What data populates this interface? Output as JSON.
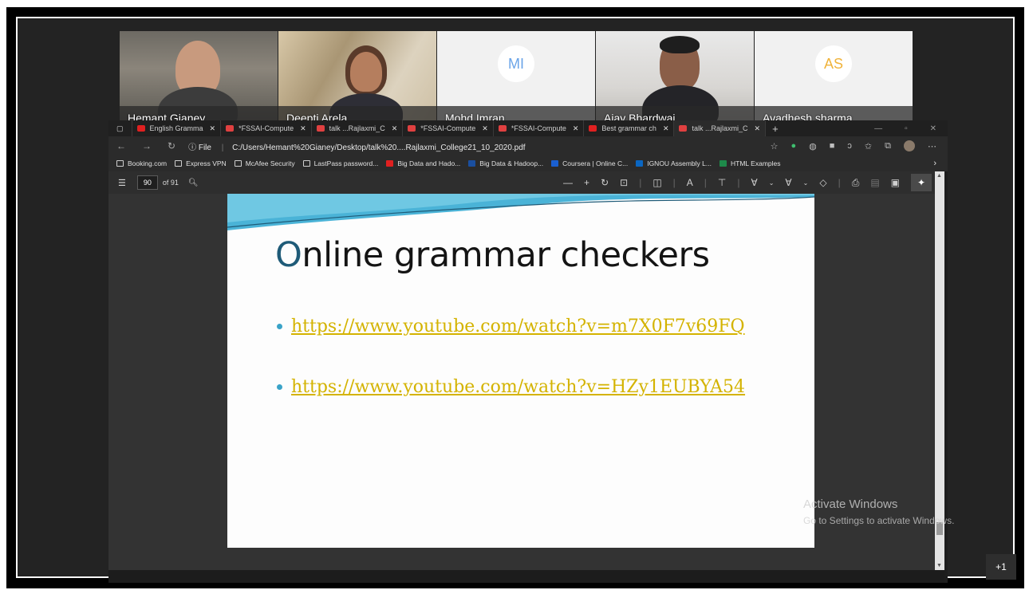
{
  "participants": [
    {
      "name": "Hemant Gianey",
      "type": "video"
    },
    {
      "name": "Deepti Arela",
      "type": "video"
    },
    {
      "name": "Mohd Imran",
      "type": "avatar",
      "initials": "MI"
    },
    {
      "name": "Ajay Bhardwaj",
      "type": "video"
    },
    {
      "name": "Avadhesh sharma",
      "type": "avatar",
      "initials": "AS"
    }
  ],
  "browser": {
    "tabs": [
      {
        "label": "English Gramma",
        "icon": "youtube-icon"
      },
      {
        "label": "*FSSAI-Compute",
        "icon": "pdf-icon"
      },
      {
        "label": "talk ...Rajlaxmi_C",
        "icon": "pdf-icon"
      },
      {
        "label": "*FSSAI-Compute",
        "icon": "pdf-icon"
      },
      {
        "label": "*FSSAI-Compute",
        "icon": "pdf-icon"
      },
      {
        "label": "Best grammar ch",
        "icon": "youtube-icon"
      },
      {
        "label": "talk ...Rajlaxmi_C",
        "icon": "pdf-icon",
        "active": true
      }
    ],
    "address": {
      "scheme_label": "File",
      "path": "C:/Users/Hemant%20Gianey/Desktop/talk%20....Rajlaxmi_College21_10_2020.pdf"
    },
    "bookmarks": [
      {
        "label": "Booking.com",
        "icon": "page-icon"
      },
      {
        "label": "Express VPN",
        "icon": "page-icon"
      },
      {
        "label": "McAfee Security",
        "icon": "page-icon"
      },
      {
        "label": "LastPass password...",
        "icon": "page-icon"
      },
      {
        "label": "Big Data and Hado...",
        "icon": "youtube-icon"
      },
      {
        "label": "Big Data & Hadoop...",
        "icon": "page-icon"
      },
      {
        "label": "Coursera | Online C...",
        "icon": "coursera-icon"
      },
      {
        "label": "IGNOU Assembly L...",
        "icon": "linkedin-icon"
      },
      {
        "label": "HTML Examples",
        "icon": "w3-icon"
      }
    ],
    "pdf_toolbar": {
      "page_current": "90",
      "page_total": "of 91"
    }
  },
  "slide": {
    "title_first": "O",
    "title_rest": "nline grammar checkers",
    "links": [
      "https://www.youtube.com/watch?v=m7X0F7v69FQ",
      "https://www.youtube.com/watch?v=HZy1EUBYA54"
    ]
  },
  "overlay": {
    "activate_title": "Activate Windows",
    "activate_sub": "Go to Settings to activate Windows.",
    "more_participants": "+1"
  },
  "colors": {
    "title_accent": "#1f5b78",
    "link": "#d4b300",
    "bullet": "#3aa3c8"
  }
}
